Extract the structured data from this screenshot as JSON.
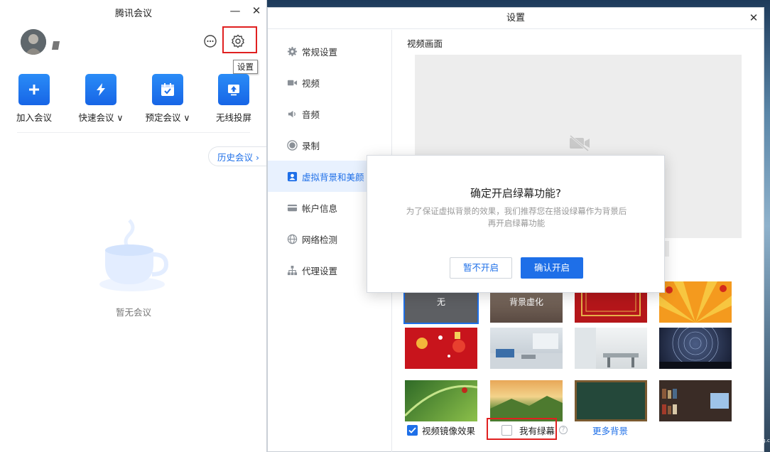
{
  "main_window": {
    "title": "腾讯会议",
    "minimize": "—",
    "close": "✕",
    "settings_tooltip": "设置",
    "actions": [
      {
        "label": "加入会议"
      },
      {
        "label": "快速会议 ∨"
      },
      {
        "label": "预定会议 ∨"
      },
      {
        "label": "无线投屏"
      }
    ],
    "history_label": "历史会议 ›",
    "empty_text": "暂无会议"
  },
  "settings_window": {
    "title": "设置",
    "close": "✕",
    "nav": [
      {
        "label": "常规设置",
        "icon": "gear-icon"
      },
      {
        "label": "视频",
        "icon": "video-icon"
      },
      {
        "label": "音频",
        "icon": "speaker-icon"
      },
      {
        "label": "录制",
        "icon": "record-icon"
      },
      {
        "label": "虚拟背景和美颜",
        "icon": "portrait-icon",
        "active": true
      },
      {
        "label": "帐户信息",
        "icon": "card-icon"
      },
      {
        "label": "网络检测",
        "icon": "globe-icon"
      },
      {
        "label": "代理设置",
        "icon": "network-icon"
      }
    ],
    "section_title": "视频画面",
    "backgrounds": [
      {
        "label": "无",
        "selected": true
      },
      {
        "label": "背景虚化"
      }
    ],
    "mirror_label": "视频镜像效果",
    "mirror_checked": true,
    "green_screen_label": "我有绿幕",
    "green_screen_checked": false,
    "more_backgrounds": "更多背景"
  },
  "dialog": {
    "title": "确定开启绿幕功能?",
    "body": "为了保证虚拟背景的效果，我们推荐您在搭设绿幕作为背景后再开启绿幕功能",
    "cancel_label": "暂不开启",
    "confirm_label": "确认开启"
  },
  "watermark": {
    "big": "CC",
    "small": "www.52maicong.com"
  },
  "colors": {
    "accent": "#1e6fe8",
    "highlight_border": "#e02020"
  }
}
